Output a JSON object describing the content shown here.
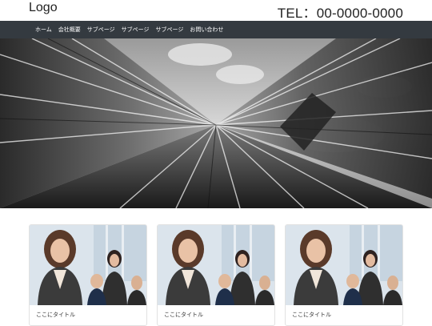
{
  "header": {
    "logo": "Logo",
    "tel": "TEL：00-0000-0000"
  },
  "nav": {
    "items": [
      {
        "label": "ホーム"
      },
      {
        "label": "会社概要"
      },
      {
        "label": "サブページ"
      },
      {
        "label": "サブページ"
      },
      {
        "label": "サブページ"
      },
      {
        "label": "お問い合わせ"
      }
    ]
  },
  "hero": {
    "image": "skyscraper-glass-building-photo"
  },
  "cards": [
    {
      "title": "ここにタイトル",
      "image": "business-team-photo"
    },
    {
      "title": "ここにタイトル",
      "image": "business-team-photo"
    },
    {
      "title": "ここにタイトル",
      "image": "business-team-photo"
    }
  ]
}
